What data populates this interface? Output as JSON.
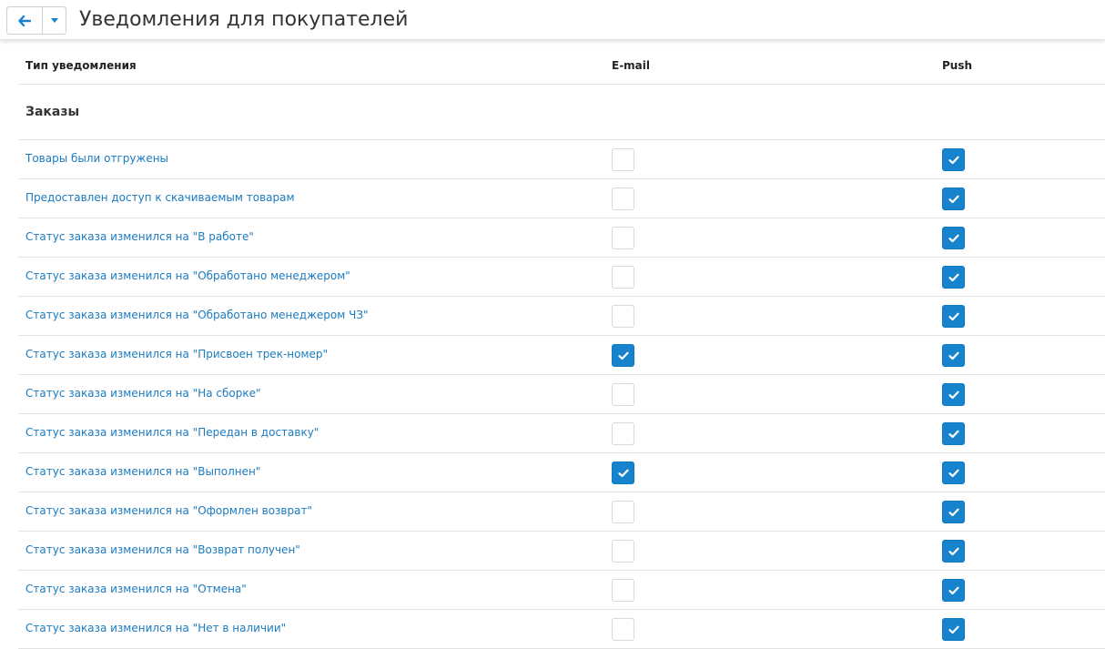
{
  "header": {
    "title": "Уведомления для покупателей",
    "back_icon": "arrow-left-icon",
    "dropdown_icon": "caret-down-icon"
  },
  "table": {
    "columns": {
      "type": "Тип уведомления",
      "email": "E-mail",
      "push": "Push"
    },
    "section_title": "Заказы",
    "rows": [
      {
        "label": "Товары были отгружены",
        "email": false,
        "push": true
      },
      {
        "label": "Предоставлен доступ к скачиваемым товарам",
        "email": false,
        "push": true
      },
      {
        "label": "Статус заказа изменился на \"В работе\"",
        "email": false,
        "push": true
      },
      {
        "label": "Статус заказа изменился на \"Обработано менеджером\"",
        "email": false,
        "push": true
      },
      {
        "label": "Статус заказа изменился на \"Обработано менеджером ЧЗ\"",
        "email": false,
        "push": true
      },
      {
        "label": "Статус заказа изменился на \"Присвоен трек-номер\"",
        "email": true,
        "push": true
      },
      {
        "label": "Статус заказа изменился на \"На сборке\"",
        "email": false,
        "push": true
      },
      {
        "label": "Статус заказа изменился на \"Передан в доставку\"",
        "email": false,
        "push": true
      },
      {
        "label": "Статус заказа изменился на \"Выполнен\"",
        "email": true,
        "push": true
      },
      {
        "label": "Статус заказа изменился на \"Оформлен возврат\"",
        "email": false,
        "push": true
      },
      {
        "label": "Статус заказа изменился на \"Возврат получен\"",
        "email": false,
        "push": true
      },
      {
        "label": "Статус заказа изменился на \"Отмена\"",
        "email": false,
        "push": true
      },
      {
        "label": "Статус заказа изменился на \"Нет в наличии\"",
        "email": false,
        "push": true
      }
    ]
  },
  "colors": {
    "accent": "#1683cc",
    "link": "#1b7bc0",
    "border": "#e2e2e2"
  }
}
